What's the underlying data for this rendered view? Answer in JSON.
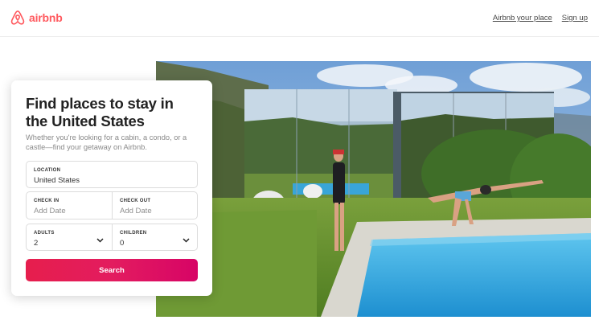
{
  "header": {
    "logo_text": "airbnb",
    "nav": {
      "host_label": "Airbnb your place",
      "signup_label": "Sign up"
    }
  },
  "colors": {
    "brand": "#ff5a5f",
    "search_gradient": [
      "#e61e4d",
      "#d70466"
    ]
  },
  "search_card": {
    "title": "Find places to stay in the United States",
    "subtitle": "Whether you're looking for a cabin, a condo, or a castle—find your getaway on Airbnb.",
    "location": {
      "label": "LOCATION",
      "value": "United States"
    },
    "check_in": {
      "label": "CHECK IN",
      "placeholder": "Add Date"
    },
    "check_out": {
      "label": "CHECK OUT",
      "placeholder": "Add Date"
    },
    "adults": {
      "label": "ADULTS",
      "value": "2"
    },
    "children": {
      "label": "CHILDREN",
      "value": "0"
    },
    "search_label": "Search"
  },
  "hero_image": {
    "subject": "photo-pool-mirror-house"
  }
}
